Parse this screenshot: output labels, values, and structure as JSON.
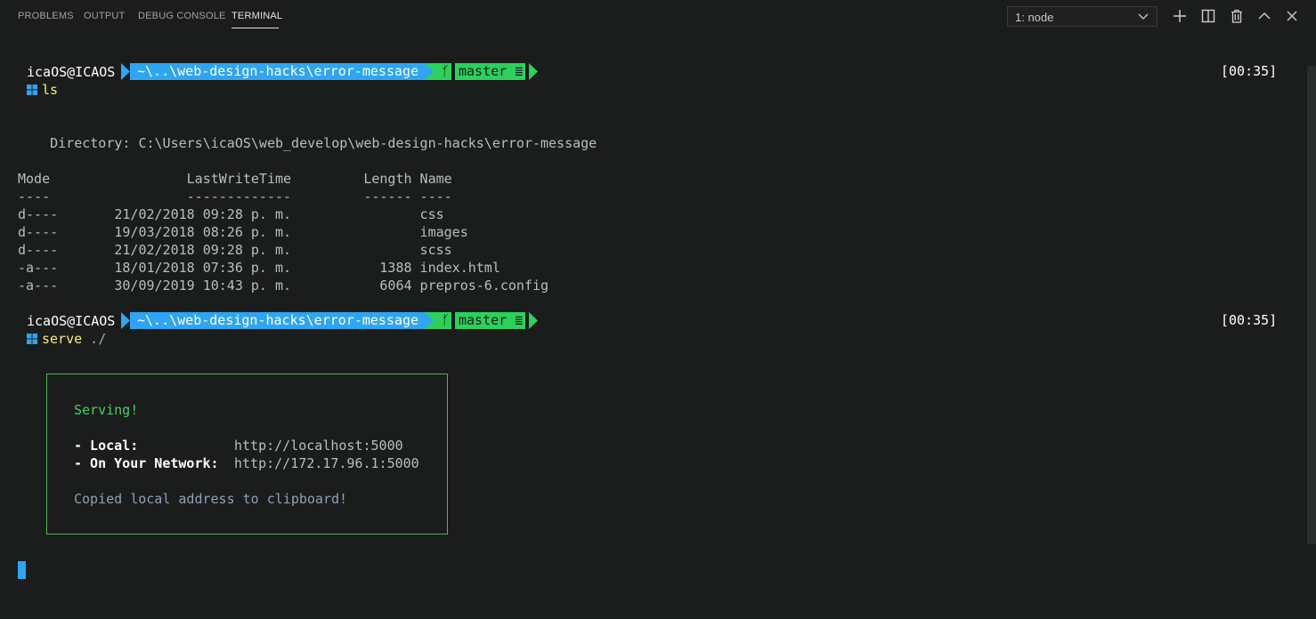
{
  "tabs": [
    {
      "label": "PROBLEMS",
      "active": false
    },
    {
      "label": "OUTPUT",
      "active": false
    },
    {
      "label": "DEBUG CONSOLE",
      "active": false
    },
    {
      "label": "TERMINAL",
      "active": true
    }
  ],
  "terminal_select": {
    "value": "1: node"
  },
  "toolbar_icons": [
    "plus-icon",
    "split-icon",
    "trash-icon",
    "chevron-up-icon",
    "close-icon"
  ],
  "colors": {
    "accent_path": "#2ea5f2",
    "accent_git": "#2bd15b",
    "background": "#1b1c1c"
  },
  "prompts": [
    {
      "user": "icaOS@ICAOS",
      "path": "~\\..\\web-design-hacks\\error-message",
      "branch_icon": "ᚶ",
      "branch": "master ≣",
      "time": "[00:35]",
      "command": "ls",
      "args": ""
    },
    {
      "user": "icaOS@ICAOS",
      "path": "~\\..\\web-design-hacks\\error-message",
      "branch_icon": "ᚶ",
      "branch": "master ≣",
      "time": "[00:35]",
      "command": "serve",
      "args": " ./"
    }
  ],
  "ls_output": {
    "directory_line": "    Directory: C:\\Users\\icaOS\\web_develop\\web-design-hacks\\error-message",
    "header": "Mode                 LastWriteTime         Length Name",
    "separator": "----                 -------------         ------ ----",
    "rows": [
      "d----       21/02/2018 09:28 p. m.                css",
      "d----       19/03/2018 08:26 p. m.                images",
      "d----       21/02/2018 09:28 p. m.                scss",
      "-a---       18/01/2018 07:36 p. m.           1388 index.html",
      "-a---       30/09/2019 10:43 p. m.           6064 prepros-6.config"
    ]
  },
  "serve_box": {
    "status": "Serving!",
    "local_label": "- Local:",
    "local_url": "http://localhost:5000",
    "network_label": "- On Your Network:",
    "network_url": "http://172.17.96.1:5000",
    "note": "Copied local address to clipboard!"
  }
}
